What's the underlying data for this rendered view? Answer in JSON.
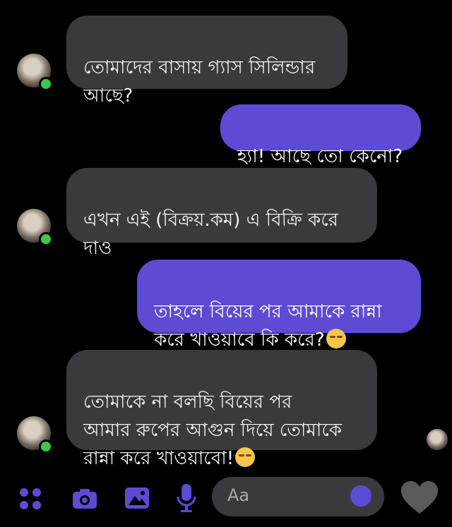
{
  "messages": [
    {
      "side": "incoming",
      "text": "তোমাদের বাসায় গ্যাস সিলিন্ডার\nআছে?"
    },
    {
      "side": "outgoing",
      "text": "হ্যা! আছে তো কেনো?"
    },
    {
      "side": "incoming",
      "text": "এখন এই (বিক্রয়.কম) এ বিক্রি করে\nদাও"
    },
    {
      "side": "outgoing",
      "text": "তাহলে বিয়ের পর আমাকে রান্না\nকরে খাওয়াবে কি করে?"
    },
    {
      "side": "incoming",
      "text": "তোমাকে না বলছি বিয়ের পর\nআমার রুপের আগুন দিয়ে তোমাকে\nরান্না করে খাওয়াবো!"
    }
  ],
  "composer": {
    "placeholder": "Aa",
    "icons": [
      "apps-icon",
      "camera-icon",
      "gallery-icon",
      "microphone-icon",
      "emoji-icon",
      "heart-icon"
    ]
  },
  "colors": {
    "incoming": "#3a3a3c",
    "outgoing": "#5d4bd4",
    "accent": "#5d4bd4",
    "online": "#3ac84a"
  }
}
